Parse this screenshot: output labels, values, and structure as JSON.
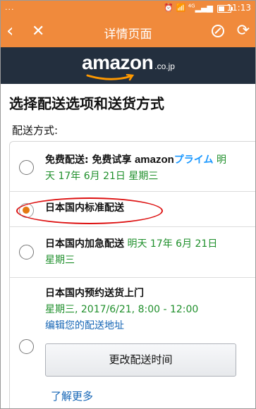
{
  "status_bar": {
    "dots": "...",
    "signal_label": "4G",
    "time": "11:13"
  },
  "title_bar": {
    "title": "详情页面"
  },
  "brand": {
    "logo_word": "amazon",
    "logo_tld": ".co.jp"
  },
  "page": {
    "heading": "选择配送选项和送货方式",
    "section_label": "配送方式:"
  },
  "options": [
    {
      "label": "免费配送: 免费试享",
      "brand_word": "amazon",
      "brand_suffix": "プライム",
      "date_prefix": "明",
      "date_line2": "天 17年 6月 21日 星期三",
      "selected": false
    },
    {
      "label": "日本国内标准配送",
      "selected": true
    },
    {
      "label": "日本国内加急配送",
      "date_inline": "明天 17年 6月 21日",
      "date_line2": "星期三",
      "selected": false
    },
    {
      "label": "日本国内预约送货上门",
      "schedule": "星期三, 2017/6/21, 8:00 - 12:00",
      "edit_link": "编辑您的配送地址",
      "button": "更改配送时间",
      "learn_more": "了解更多",
      "selected": false
    }
  ],
  "colors": {
    "accent_orange": "#f08a3c",
    "header_dark": "#232f3e",
    "green_date": "#1f8f2b",
    "link_blue": "#1565b5",
    "prime_blue": "#1a98ff",
    "radio_selected": "#e47911",
    "annotation_red": "#dd1111"
  },
  "icons": [
    "back-arrow-icon",
    "close-x-icon",
    "compass-icon",
    "refresh-icon",
    "alarm-icon",
    "wifi-icon",
    "signal-icon",
    "battery-icon"
  ]
}
